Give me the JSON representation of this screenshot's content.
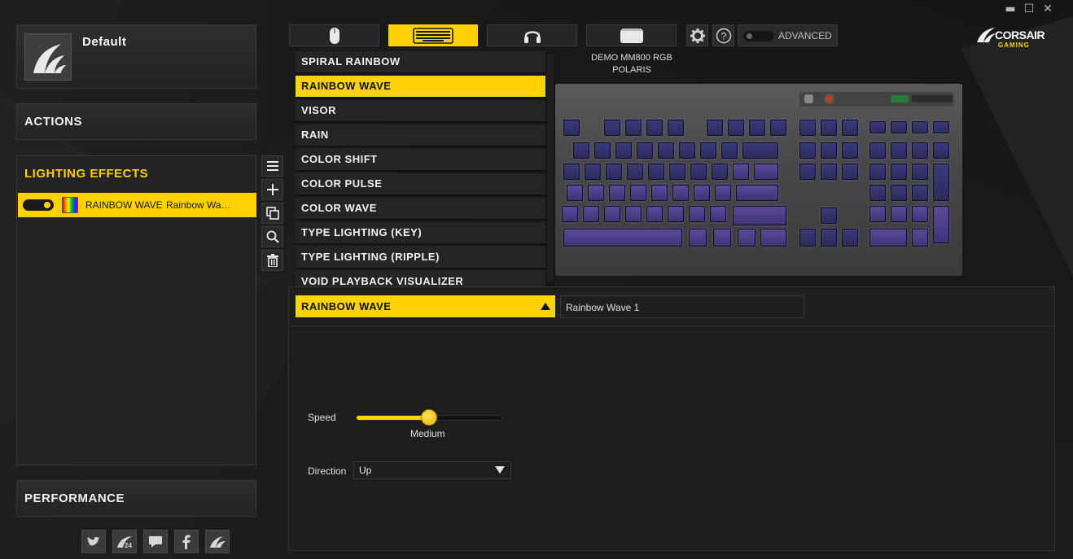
{
  "window": {
    "minimize": "▬",
    "maximize": "☐",
    "close": "✕"
  },
  "brand": {
    "name": "CORSAIR",
    "sub": "GAMING"
  },
  "profile": {
    "name": "Default"
  },
  "sections": {
    "actions": "ACTIONS",
    "lighting": "LIGHTING EFFECTS",
    "performance": "PERFORMANCE"
  },
  "effect_list": [
    {
      "name": "RAINBOW WAVE",
      "detail": "Rainbow Wave 1",
      "enabled": true
    }
  ],
  "tools": [
    "menu-icon",
    "add-icon",
    "copy-icon",
    "search-icon",
    "trash-icon"
  ],
  "social": [
    "twitter-icon",
    "corsair-24-icon",
    "chat-icon",
    "facebook-icon",
    "corsair-sails-icon"
  ],
  "device_tabs": [
    {
      "icon": "mouse-icon",
      "active": false
    },
    {
      "icon": "keyboard-icon",
      "active": true
    },
    {
      "icon": "headset-icon",
      "active": false
    },
    {
      "icon": "mousepad-icon",
      "active": false
    }
  ],
  "advanced": {
    "label": "ADVANCED"
  },
  "device_caption": {
    "line1": "DEMO MM800 RGB",
    "line2": "POLARIS"
  },
  "effect_menu": [
    "SPIRAL RAINBOW",
    "RAINBOW WAVE",
    "VISOR",
    "RAIN",
    "COLOR SHIFT",
    "COLOR PULSE",
    "COLOR WAVE",
    "TYPE LIGHTING (KEY)",
    "TYPE LIGHTING (RIPPLE)",
    "VOID PLAYBACK VISUALIZER"
  ],
  "effect_menu_selected": "RAINBOW WAVE",
  "effect_select": {
    "value": "RAINBOW WAVE"
  },
  "effect_name_field": {
    "value": "Rainbow Wave 1"
  },
  "speed": {
    "label": "Speed",
    "value_label": "Medium",
    "level": 0.5
  },
  "direction": {
    "label": "Direction",
    "value": "Up"
  },
  "colors": {
    "accent": "#ffd200",
    "background": "#1d1d1d",
    "panel": "#2a2a2a"
  }
}
